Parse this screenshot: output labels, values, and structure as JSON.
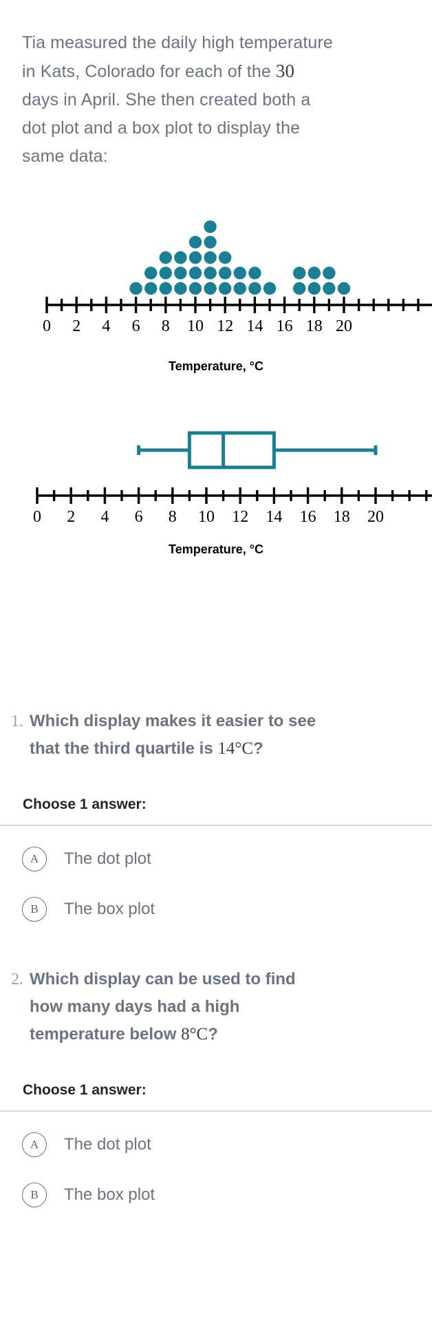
{
  "prompt": {
    "line1": "Tia measured the daily high temperature",
    "line2a": "in Kats, Colorado for each of the ",
    "line2b": "30",
    "line3": "days in April. She then created both a",
    "line4": "dot plot and a box plot to display the",
    "line5": "same data:"
  },
  "colors": {
    "accent": "#1a7f94",
    "text_gray": "#6b7280",
    "axis_black": "#000000",
    "divider": "#d6d8da"
  },
  "chart_data": [
    {
      "type": "dotplot",
      "title": "",
      "xlabel": "Temperature, °C",
      "ylabel": "",
      "xlim": [
        0,
        21
      ],
      "xticks": [
        0,
        1,
        2,
        3,
        4,
        5,
        6,
        7,
        8,
        9,
        10,
        11,
        12,
        13,
        14,
        15,
        16,
        17,
        18,
        19,
        20,
        21
      ],
      "xticklabels": [
        "0",
        "",
        "2",
        "",
        "4",
        "",
        "6",
        "",
        "8",
        "",
        "10",
        "",
        "12",
        "",
        "14",
        "",
        "16",
        "",
        "18",
        "",
        "20",
        ""
      ],
      "labeled_ticks": [
        0,
        2,
        4,
        6,
        8,
        10,
        12,
        14,
        16,
        18,
        20
      ],
      "grid": false,
      "legend": "none",
      "dot_color": "#1a7f94",
      "categories": [
        6,
        7,
        8,
        9,
        10,
        11,
        12,
        13,
        14,
        15,
        16,
        17,
        18,
        19,
        20
      ],
      "values": [
        1,
        2,
        3,
        3,
        4,
        5,
        3,
        2,
        2,
        1,
        0,
        2,
        2,
        2,
        1
      ],
      "total_dots": 30
    },
    {
      "type": "boxplot",
      "title": "",
      "xlabel": "Temperature, °C",
      "xlim": [
        0,
        21
      ],
      "xticks": [
        0,
        1,
        2,
        3,
        4,
        5,
        6,
        7,
        8,
        9,
        10,
        11,
        12,
        13,
        14,
        15,
        16,
        17,
        18,
        19,
        20,
        21
      ],
      "labeled_ticks": [
        0,
        2,
        4,
        6,
        8,
        10,
        12,
        14,
        16,
        18,
        20
      ],
      "grid": false,
      "box_color": "#1a7f94",
      "five_number_summary": {
        "min": 6,
        "q1": 9,
        "median": 11,
        "q3": 14,
        "max": 20
      }
    }
  ],
  "questions": [
    {
      "number": "1.",
      "line1": "Which display makes it easier to see",
      "line2a": "that the third quartile is ",
      "line2b": "14°C",
      "line2c": "?",
      "choose_label": "Choose 1 answer:",
      "choices": [
        {
          "letter": "A",
          "text": "The dot plot"
        },
        {
          "letter": "B",
          "text": "The box plot"
        }
      ]
    },
    {
      "number": "2.",
      "line1": "Which display can be used to find",
      "line2": "how many days had a high",
      "line3a": "temperature below ",
      "line3b": "8°C",
      "line3c": "?",
      "choose_label": "Choose 1 answer:",
      "choices": [
        {
          "letter": "A",
          "text": "The dot plot"
        },
        {
          "letter": "B",
          "text": "The box plot"
        }
      ]
    }
  ]
}
